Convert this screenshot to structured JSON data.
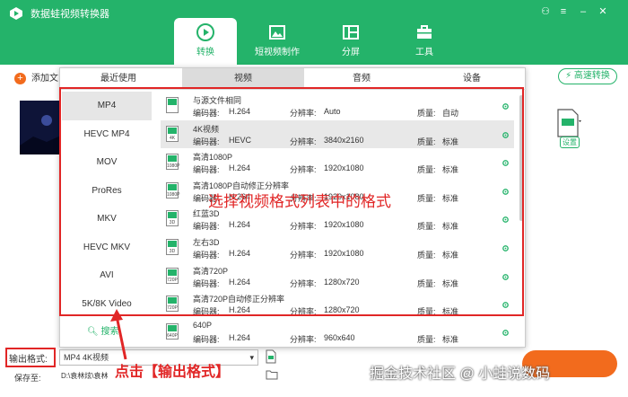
{
  "app": {
    "title": "数据蛙视频转换器"
  },
  "nav": {
    "tabs": [
      {
        "label": "转换",
        "icon": "convert-icon"
      },
      {
        "label": "短视频制作",
        "icon": "image-icon"
      },
      {
        "label": "分屏",
        "icon": "split-screen-icon"
      },
      {
        "label": "工具",
        "icon": "toolbox-icon"
      }
    ]
  },
  "toolbar": {
    "add_file": "添加文",
    "fast_convert": "高速转换"
  },
  "file_settings": {
    "label": "设置"
  },
  "popup": {
    "tabs": [
      "最近使用",
      "视频",
      "音频",
      "设备"
    ],
    "categories": [
      "MP4",
      "HEVC MP4",
      "MOV",
      "ProRes",
      "MKV",
      "HEVC MKV",
      "AVI",
      "5K/8K Video"
    ],
    "search": "搜索",
    "field_labels": {
      "encoder": "编码器:",
      "resolution": "分辨率:",
      "quality": "质量:"
    },
    "presets": [
      {
        "name": "与源文件相同",
        "encoder": "H.264",
        "resolution": "Auto",
        "quality": "自动",
        "badge": ""
      },
      {
        "name": "4K视频",
        "encoder": "HEVC",
        "resolution": "3840x2160",
        "quality": "标准",
        "badge": "4K"
      },
      {
        "name": "高清1080P",
        "encoder": "H.264",
        "resolution": "1920x1080",
        "quality": "标准",
        "badge": "1080P"
      },
      {
        "name": "高清1080P自动修正分辨率",
        "encoder": "H.264",
        "resolution": "1920x1080",
        "quality": "标准",
        "badge": "1080P"
      },
      {
        "name": "红蓝3D",
        "encoder": "H.264",
        "resolution": "1920x1080",
        "quality": "标准",
        "badge": "3D"
      },
      {
        "name": "左右3D",
        "encoder": "H.264",
        "resolution": "1920x1080",
        "quality": "标准",
        "badge": "3D"
      },
      {
        "name": "高清720P",
        "encoder": "H.264",
        "resolution": "1280x720",
        "quality": "标准",
        "badge": "720P"
      },
      {
        "name": "高清720P自动修正分辨率",
        "encoder": "H.264",
        "resolution": "1280x720",
        "quality": "标准",
        "badge": "720P"
      },
      {
        "name": "640P",
        "encoder": "H.264",
        "resolution": "960x640",
        "quality": "标准",
        "badge": "640P"
      }
    ]
  },
  "annotation": {
    "instruction": "选择视频格式列表中的格式",
    "click_hint": "点击【输出格式】"
  },
  "bottom": {
    "output_format_label": "输出格式:",
    "output_format_value": "MP4 4K视频",
    "save_to_label": "保存至:",
    "save_path": "D:\\袁林炫\\袁林"
  },
  "watermark": "掘金技术社区 @ 小蛙说数码",
  "colors": {
    "brand_green": "#24b36a",
    "accent_orange": "#f26b1d",
    "annotation_red": "#e12626"
  }
}
